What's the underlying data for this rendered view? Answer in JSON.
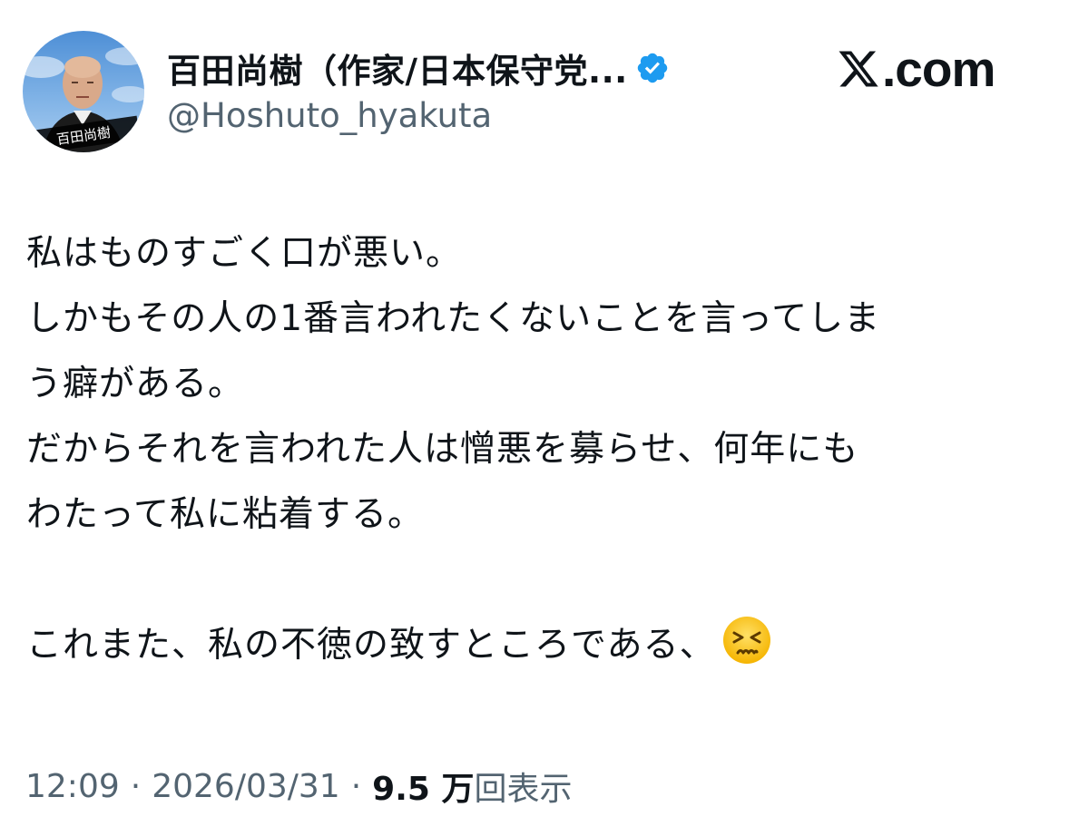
{
  "post": {
    "author": {
      "display_name": "百田尚樹（作家/日本保守党...",
      "handle": "@Hoshuto_hyakuta",
      "avatar_caption": "百田尚樹",
      "verified_icon": "verified-badge-icon",
      "verified_color": "#1d9bf0"
    },
    "brand": {
      "logo_icon": "x-logo-icon",
      "text": ".com"
    },
    "text_lines": [
      "私はものすごく口が悪い。",
      "しかもその人の1番言われたくないことを言ってしま",
      "う癖がある。",
      "だからそれを言われた人は憎悪を募らせ、何年にも",
      "わたって私に粘着する。",
      "",
      "これまた、私の不徳の致すところである、"
    ],
    "emoji": "persevering-face-emoji",
    "meta": {
      "time": "12:09",
      "separator": "·",
      "date": "2026/03/31",
      "views_count": "9.5 万",
      "views_label": "回表示"
    }
  }
}
